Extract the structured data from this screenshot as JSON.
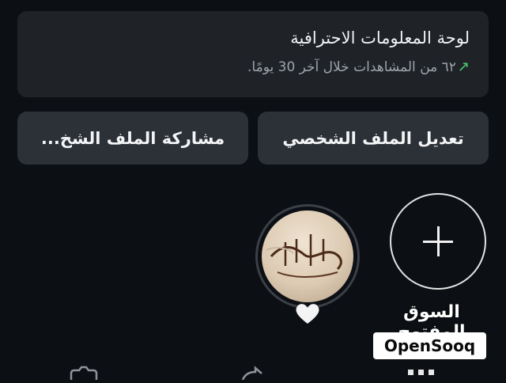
{
  "dashboard": {
    "title": "لوحة المعلومات الاحترافية",
    "trend_icon": "arrow-up-right-icon",
    "subtitle": "٦٢ من المشاهدات خلال آخر 30 يومًا."
  },
  "actions": {
    "edit_profile": "تعديل الملف الشخصي",
    "share_profile": "مشاركة الملف الشخ..."
  },
  "stories": {
    "add_icon": "plus-icon",
    "highlight_image_text": "أستغفر الله",
    "highlight_badge_icon": "heart-icon"
  },
  "watermark": {
    "arabic": "السوق المفتوح",
    "latin": "OpenSooq"
  },
  "colors": {
    "background": "#0c0f14",
    "card": "#1f2328",
    "button": "#2c3037",
    "trend_green": "#4ccf6b"
  }
}
